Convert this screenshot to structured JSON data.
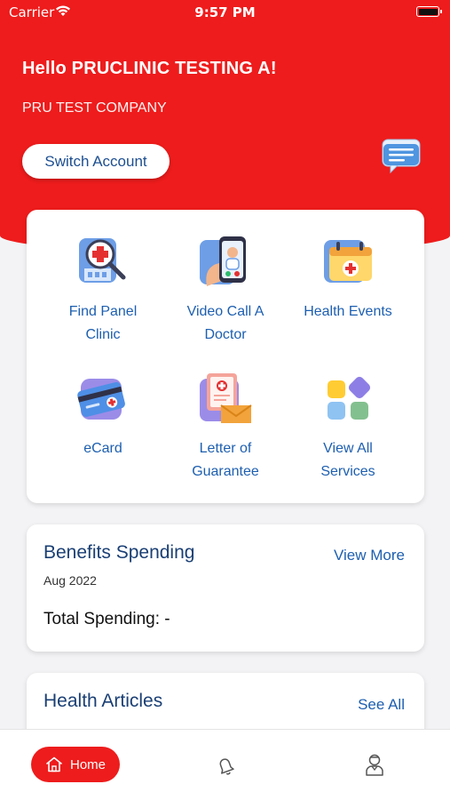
{
  "status_bar": {
    "carrier": "Carrier",
    "time": "9:57 PM"
  },
  "header": {
    "greeting": "Hello PRUCLINIC TESTING A!",
    "company": "PRU TEST COMPANY",
    "switch_account_label": "Switch Account",
    "chat_icon": "chat-bubble-icon"
  },
  "services": [
    {
      "label_line1": "Find Panel",
      "label_line2": "Clinic",
      "icon": "find-clinic-icon"
    },
    {
      "label_line1": "Video Call A",
      "label_line2": "Doctor",
      "icon": "video-call-icon"
    },
    {
      "label_line1": "Health Events",
      "label_line2": "",
      "icon": "health-events-icon"
    },
    {
      "label_line1": "eCard",
      "label_line2": "",
      "icon": "ecard-icon"
    },
    {
      "label_line1": "Letter of",
      "label_line2": "Guarantee",
      "icon": "letter-icon"
    },
    {
      "label_line1": "View All",
      "label_line2": "Services",
      "icon": "view-all-icon"
    }
  ],
  "benefits": {
    "title": "Benefits Spending",
    "link": "View More",
    "period": "Aug 2022",
    "total": "Total Spending: -"
  },
  "articles": {
    "title": "Health Articles",
    "link": "See All"
  },
  "tab_bar": {
    "home_label": "Home"
  },
  "colors": {
    "brand_red": "#ee1c1c",
    "link_blue": "#1d5fb0",
    "title_navy": "#1a3f74"
  }
}
